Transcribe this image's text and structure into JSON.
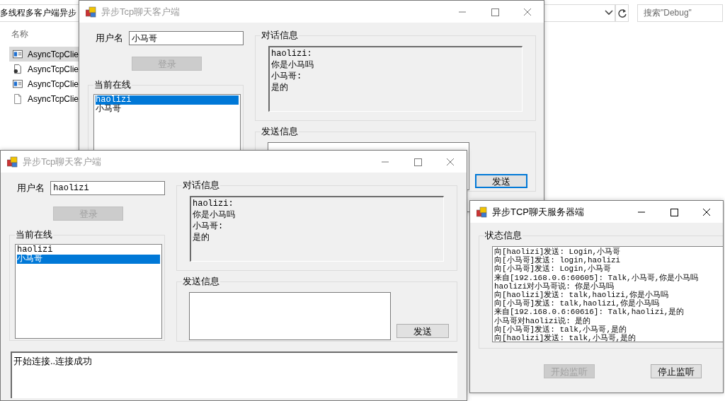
{
  "explorer": {
    "address": "多线程多客户端异步",
    "search_placeholder": "搜索\"Debug\"",
    "column_header": "名称",
    "files": [
      {
        "name": "AsyncTcpClie",
        "kind": "app",
        "selected": true
      },
      {
        "name": "AsyncTcpClie",
        "kind": "config",
        "selected": false
      },
      {
        "name": "AsyncTcpClie",
        "kind": "app",
        "selected": false
      },
      {
        "name": "AsyncTcpClie",
        "kind": "file",
        "selected": false
      }
    ]
  },
  "clients": [
    {
      "title": "异步Tcp聊天客户端",
      "active": false,
      "username_label": "用户名",
      "username": "小马哥",
      "login_button": {
        "label": "登录",
        "disabled": true
      },
      "online_label": "当前在线",
      "online_users": [
        {
          "name": "haolizi",
          "selected": true
        },
        {
          "name": "小马哥",
          "selected": false
        }
      ],
      "dialog_label": "对话信息",
      "dialog_lines": [
        "haolizi:",
        "你是小马吗",
        "小马哥:",
        "是的"
      ],
      "send_label": "发送信息",
      "send_button": {
        "label": "发送",
        "focused": true
      }
    },
    {
      "title": "异步Tcp聊天客户端",
      "active": false,
      "username_label": "用户名",
      "username": "haolizi",
      "login_button": {
        "label": "登录",
        "disabled": true
      },
      "online_label": "当前在线",
      "online_users": [
        {
          "name": "haolizi",
          "selected": false
        },
        {
          "name": "小马哥",
          "selected": true
        }
      ],
      "dialog_label": "对话信息",
      "dialog_lines": [
        "haolizi:",
        "你是小马吗",
        "小马哥:",
        "是的"
      ],
      "send_label": "发送信息",
      "send_button": {
        "label": "发送",
        "focused": false
      },
      "log_lines": [
        "开始连接..连接成功"
      ]
    }
  ],
  "server": {
    "title": "异步TCP聊天服务器端",
    "active": true,
    "status_label": "状态信息",
    "status_lines": [
      "向[haolizi]发送: Login,小马哥",
      "向[小马哥]发送: login,haolizi",
      "向[小马哥]发送: Login,小马哥",
      "来自[192.168.0.6:60605]: Talk,小马哥,你是小马吗",
      "haolizi对小马哥说: 你是小马吗",
      "向[haolizi]发送: talk,haolizi,你是小马吗",
      "向[小马哥]发送: talk,haolizi,你是小马吗",
      "来自[192.168.0.6:60616]: Talk,haolizi,是的",
      "小马哥对haolizi说: 是的",
      "向[小马哥]发送: talk,小马哥,是的",
      "向[haolizi]发送: talk,小马哥,是的"
    ],
    "start_button": {
      "label": "开始监听",
      "disabled": true
    },
    "stop_button": {
      "label": "停止监听",
      "disabled": false
    }
  }
}
